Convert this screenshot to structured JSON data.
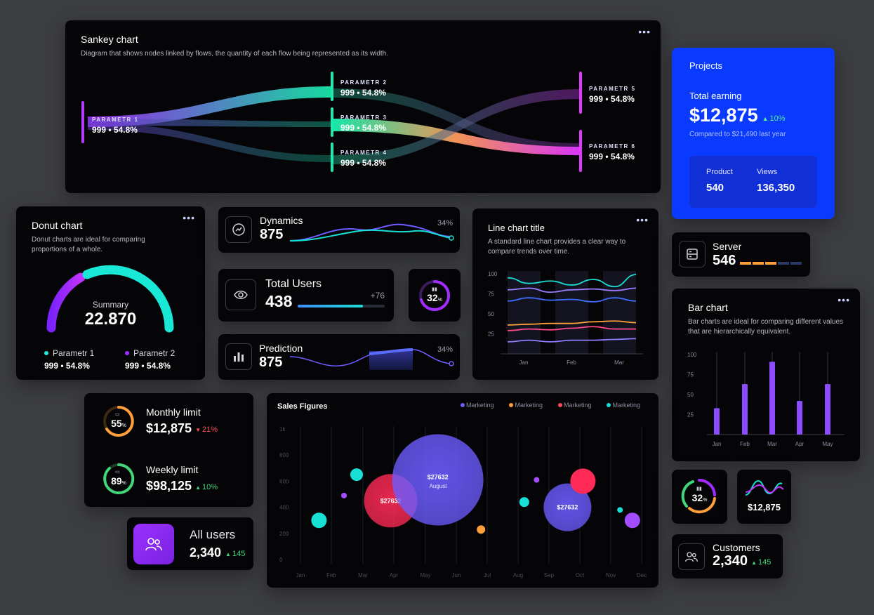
{
  "sankey": {
    "title": "Sankey chart",
    "subtitle": "Diagram that shows nodes linked by flows, the quantity of each flow being represented as its width.",
    "nodes": [
      {
        "name": "PARAMETR 1",
        "value": "999",
        "pct": "54.8%"
      },
      {
        "name": "PARAMETR 2",
        "value": "999",
        "pct": "54.8%"
      },
      {
        "name": "PARAMETR 3",
        "value": "999",
        "pct": "54.8%"
      },
      {
        "name": "PARAMETR 4",
        "value": "999",
        "pct": "54.8%"
      },
      {
        "name": "PARAMETR 5",
        "value": "999",
        "pct": "54.8%"
      },
      {
        "name": "PARAMETR 6",
        "value": "999",
        "pct": "54.8%"
      }
    ],
    "sep": "•"
  },
  "projects": {
    "title": "Projects",
    "earning_label": "Total earning",
    "earning_value": "$12,875",
    "earning_change": "10%",
    "compare": "Compared to $21,490 last year",
    "product_label": "Product",
    "product_value": "540",
    "views_label": "Views",
    "views_value": "136,350"
  },
  "donut": {
    "title": "Donut chart",
    "subtitle": "Donut charts are ideal for comparing proportions of a whole.",
    "summary_label": "Summary",
    "summary_value": "22.870",
    "legend": [
      {
        "name": "Parametr 1",
        "value": "999",
        "pct": "54.8%",
        "color": "#1de9d6"
      },
      {
        "name": "Parametr 2",
        "value": "999",
        "pct": "54.8%",
        "color": "#a22cff"
      }
    ],
    "sep": "•"
  },
  "dynamics": {
    "label": "Dynamics",
    "value": "875",
    "pct": "34%"
  },
  "total_users": {
    "label": "Total Users",
    "value": "438",
    "delta": "+76"
  },
  "small_gauge": {
    "value": "32",
    "unit": "%"
  },
  "prediction": {
    "label": "Prediction",
    "value": "875",
    "pct": "34%"
  },
  "line_chart": {
    "title": "Line chart title",
    "subtitle": "A standard line chart provides a clear way to compare trends over time."
  },
  "server": {
    "label": "Server",
    "value": "546"
  },
  "bar_card": {
    "title": "Bar chart",
    "subtitle": "Bar charts are ideal for comparing different values that are hierarchically equivalent."
  },
  "monthly": {
    "gauge": "55",
    "unit": "%",
    "label": "Monthly limit",
    "value": "$12,875",
    "change": "21%"
  },
  "weekly": {
    "gauge": "89",
    "unit": "%",
    "label": "Weekly limit",
    "value": "$98,125",
    "change": "10%"
  },
  "all_users": {
    "label": "All users",
    "value": "2,340",
    "change": "145"
  },
  "sales": {
    "title": "Sales Figures",
    "legend": [
      {
        "name": "Marketing",
        "color": "#6d5cff"
      },
      {
        "name": "Marketing",
        "color": "#ff9f3a"
      },
      {
        "name": "Marketing",
        "color": "#ff4a5f"
      },
      {
        "name": "Marketing",
        "color": "#19e0d6"
      }
    ],
    "bubble_labels": [
      "$27632",
      "$27632",
      "August",
      "$27632"
    ]
  },
  "gauge2": {
    "value": "32",
    "unit": "%"
  },
  "wave_card": {
    "value": "$12,875"
  },
  "customers": {
    "label": "Customers",
    "value": "2,340",
    "change": "145"
  },
  "chart_data": [
    {
      "type": "line",
      "title": "Line chart title",
      "categories": [
        "Jan",
        "Feb",
        "Mar"
      ],
      "ylim": [
        0,
        100
      ],
      "yticks": [
        25,
        50,
        75,
        100
      ],
      "series": [
        {
          "color": "#19e0d6",
          "values": [
            95,
            88,
            91,
            86,
            93,
            84,
            99
          ]
        },
        {
          "color": "#9b7bff",
          "values": [
            80,
            82,
            77,
            80,
            81,
            79,
            82
          ]
        },
        {
          "color": "#3f6dff",
          "values": [
            66,
            70,
            67,
            68,
            65,
            70,
            66
          ]
        },
        {
          "color": "#ff9f3a",
          "values": [
            36,
            37,
            38,
            38,
            40,
            41,
            39
          ]
        },
        {
          "color": "#ff4a8a",
          "values": [
            29,
            31,
            30,
            32,
            34,
            31,
            31
          ]
        },
        {
          "color": "#8f7cff",
          "values": [
            15,
            17,
            15,
            17,
            17,
            18,
            19
          ]
        }
      ]
    },
    {
      "type": "bar",
      "categories": [
        "Jan",
        "Feb",
        "Mar",
        "Apr",
        "May"
      ],
      "values": [
        33,
        63,
        91,
        42,
        63
      ],
      "ylim": [
        0,
        100
      ],
      "yticks": [
        25,
        50,
        75,
        100
      ]
    },
    {
      "type": "scatter",
      "title": "Sales Figures",
      "categories": [
        "Jan",
        "Feb",
        "Mar",
        "Apr",
        "May",
        "Jun",
        "Jul",
        "Aug",
        "Sep",
        "Oct",
        "Nov",
        "Dec"
      ],
      "ylim": [
        0,
        1000
      ],
      "yticks": [
        "0",
        "200",
        "400",
        "600",
        "800",
        "1k"
      ],
      "points": [
        {
          "x": 0.6,
          "y": 300,
          "r": 11,
          "color": "#19e0d6"
        },
        {
          "x": 1.4,
          "y": 490,
          "r": 4,
          "color": "#a24dff"
        },
        {
          "x": 1.8,
          "y": 650,
          "r": 9,
          "color": "#19e0d6"
        },
        {
          "x": 2.9,
          "y": 450,
          "r": 38,
          "color": "#ff2a55",
          "label": "$27632"
        },
        {
          "x": 4.4,
          "y": 610,
          "r": 65,
          "color": "#6d5cff",
          "label": "$27632"
        },
        {
          "x": 5.8,
          "y": 230,
          "r": 6,
          "color": "#ff9f3a"
        },
        {
          "x": 7.2,
          "y": 440,
          "r": 7,
          "color": "#19e0d6"
        },
        {
          "x": 7.6,
          "y": 610,
          "r": 4,
          "color": "#a24dff"
        },
        {
          "x": 8.6,
          "y": 400,
          "r": 34,
          "color": "#6d5cff",
          "label": "$27632"
        },
        {
          "x": 9.1,
          "y": 600,
          "r": 18,
          "color": "#ff2a55"
        },
        {
          "x": 10.3,
          "y": 380,
          "r": 4,
          "color": "#19e0d6"
        },
        {
          "x": 10.7,
          "y": 300,
          "r": 11,
          "color": "#a24dff"
        }
      ]
    }
  ]
}
